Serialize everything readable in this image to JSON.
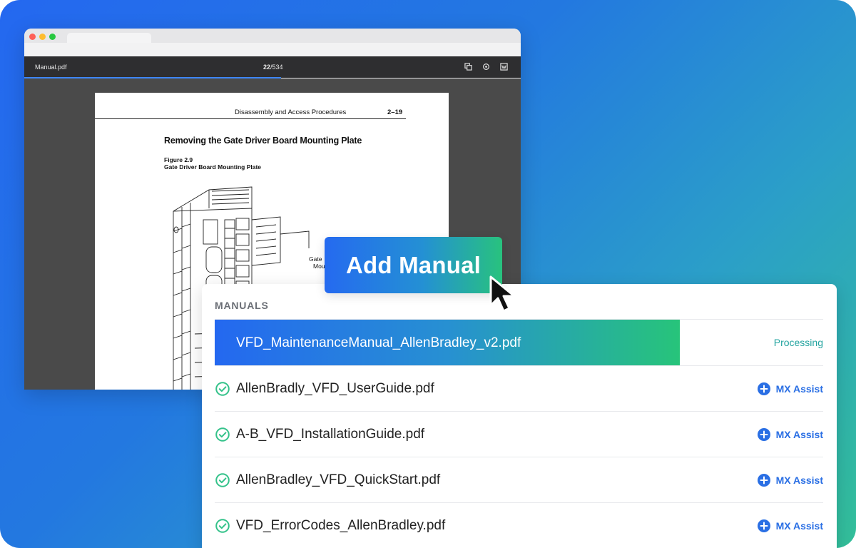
{
  "viewer": {
    "filename": "Manual.pdf",
    "page_current": "22",
    "page_total": "/534",
    "toolbar_icons": [
      "copy-icon",
      "settings-icon",
      "view-icon"
    ]
  },
  "document": {
    "header_section": "Disassembly and Access Procedures",
    "header_page": "2–19",
    "title": "Removing the Gate Driver Board Mounting Plate",
    "figure_number": "Figure 2.9",
    "figure_caption": "Gate Driver Board Mounting Plate",
    "callout_line1": "Gate",
    "callout_line2": "Mou"
  },
  "add_button": {
    "label": "Add Manual"
  },
  "manuals": {
    "heading": "MANUALS",
    "processing": {
      "name": "VFD_MaintenanceManual_AllenBradley_v2.pdf",
      "status": "Processing"
    },
    "items": [
      {
        "name": "AllenBradly_VFD_UserGuide.pdf",
        "action": "MX Assist"
      },
      {
        "name": "A-B_VFD_InstallationGuide.pdf",
        "action": "MX Assist"
      },
      {
        "name": "AllenBradley_VFD_QuickStart.pdf",
        "action": "MX Assist"
      },
      {
        "name": "VFD_ErrorCodes_AllenBradley.pdf",
        "action": "MX Assist"
      }
    ]
  },
  "colors": {
    "accent_blue": "#2468f0",
    "accent_green": "#27c47a",
    "check_green": "#34c28a",
    "assist_blue": "#2a6fe4"
  }
}
